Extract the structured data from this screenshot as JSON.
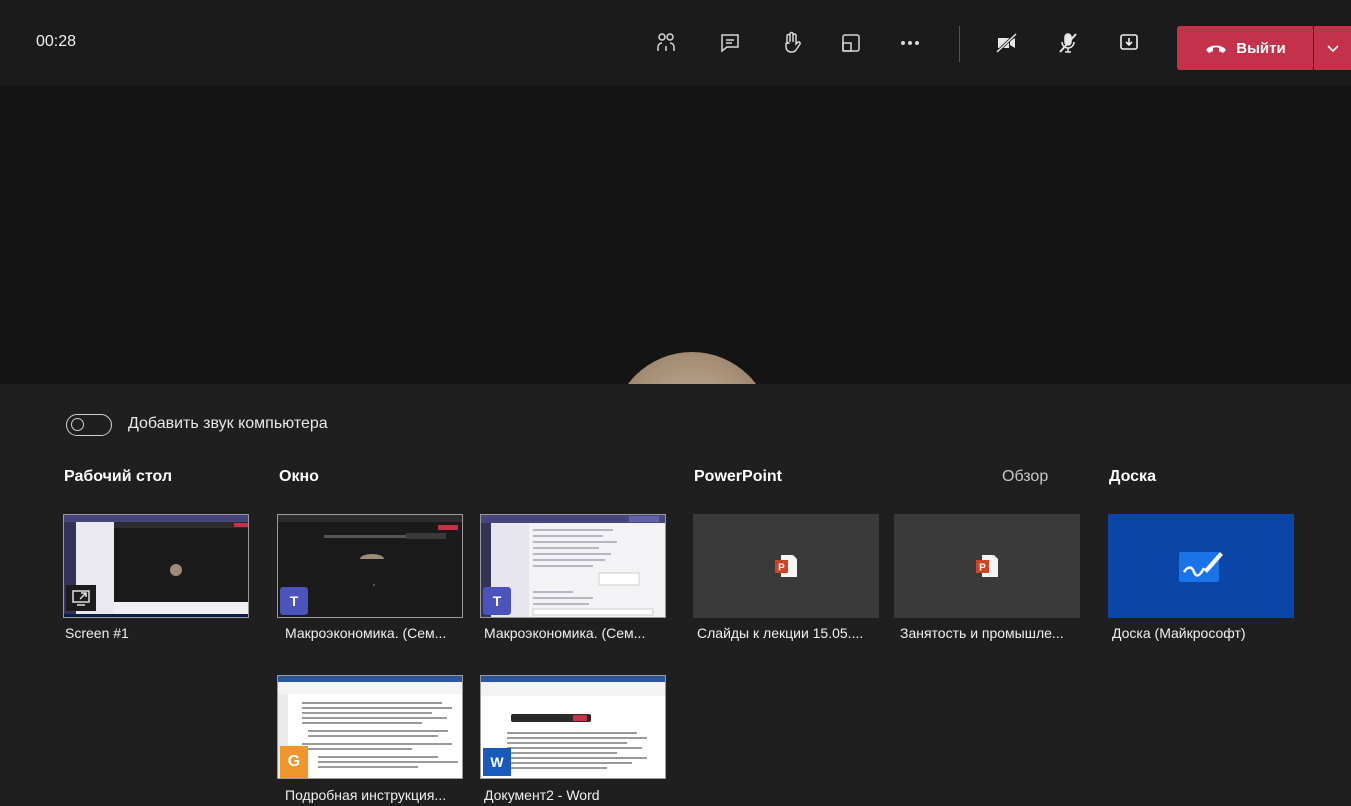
{
  "header": {
    "timer": "00:28",
    "icons": [
      "participants-icon",
      "chat-icon",
      "raise-hand-icon",
      "share-tray-icon",
      "more-actions-icon",
      "camera-off-icon",
      "mic-off-icon",
      "share-screen-icon"
    ],
    "leave_label": "Выйти"
  },
  "tray": {
    "audio_toggle_label": "Добавить звук компьютера",
    "sections": {
      "desktop": "Рабочий стол",
      "window": "Окно",
      "powerpoint": "PowerPoint",
      "browse": "Обзор",
      "whiteboard": "Доска"
    },
    "items": [
      {
        "label": "Screen #1",
        "icon": "screen-icon"
      },
      {
        "label": "Макроэкономика. (Сем...",
        "icon": "teams-icon"
      },
      {
        "label": "Макроэкономика. (Сем...",
        "icon": "teams-icon"
      },
      {
        "label": "Слайды к лекции 15.05....",
        "icon": "powerpoint-file-icon"
      },
      {
        "label": "Занятость и промышле...",
        "icon": "powerpoint-file-icon"
      },
      {
        "label": "Доска (Майкрософт)",
        "icon": "whiteboard-icon"
      },
      {
        "label": "Подробная инструкция...",
        "icon": "app-icon"
      },
      {
        "label": "Документ2 - Word",
        "icon": "word-icon"
      }
    ]
  },
  "colors": {
    "accent_leave": "#c4314b",
    "whiteboard_tile": "#0a46a8",
    "background": "#1f1f1f"
  }
}
